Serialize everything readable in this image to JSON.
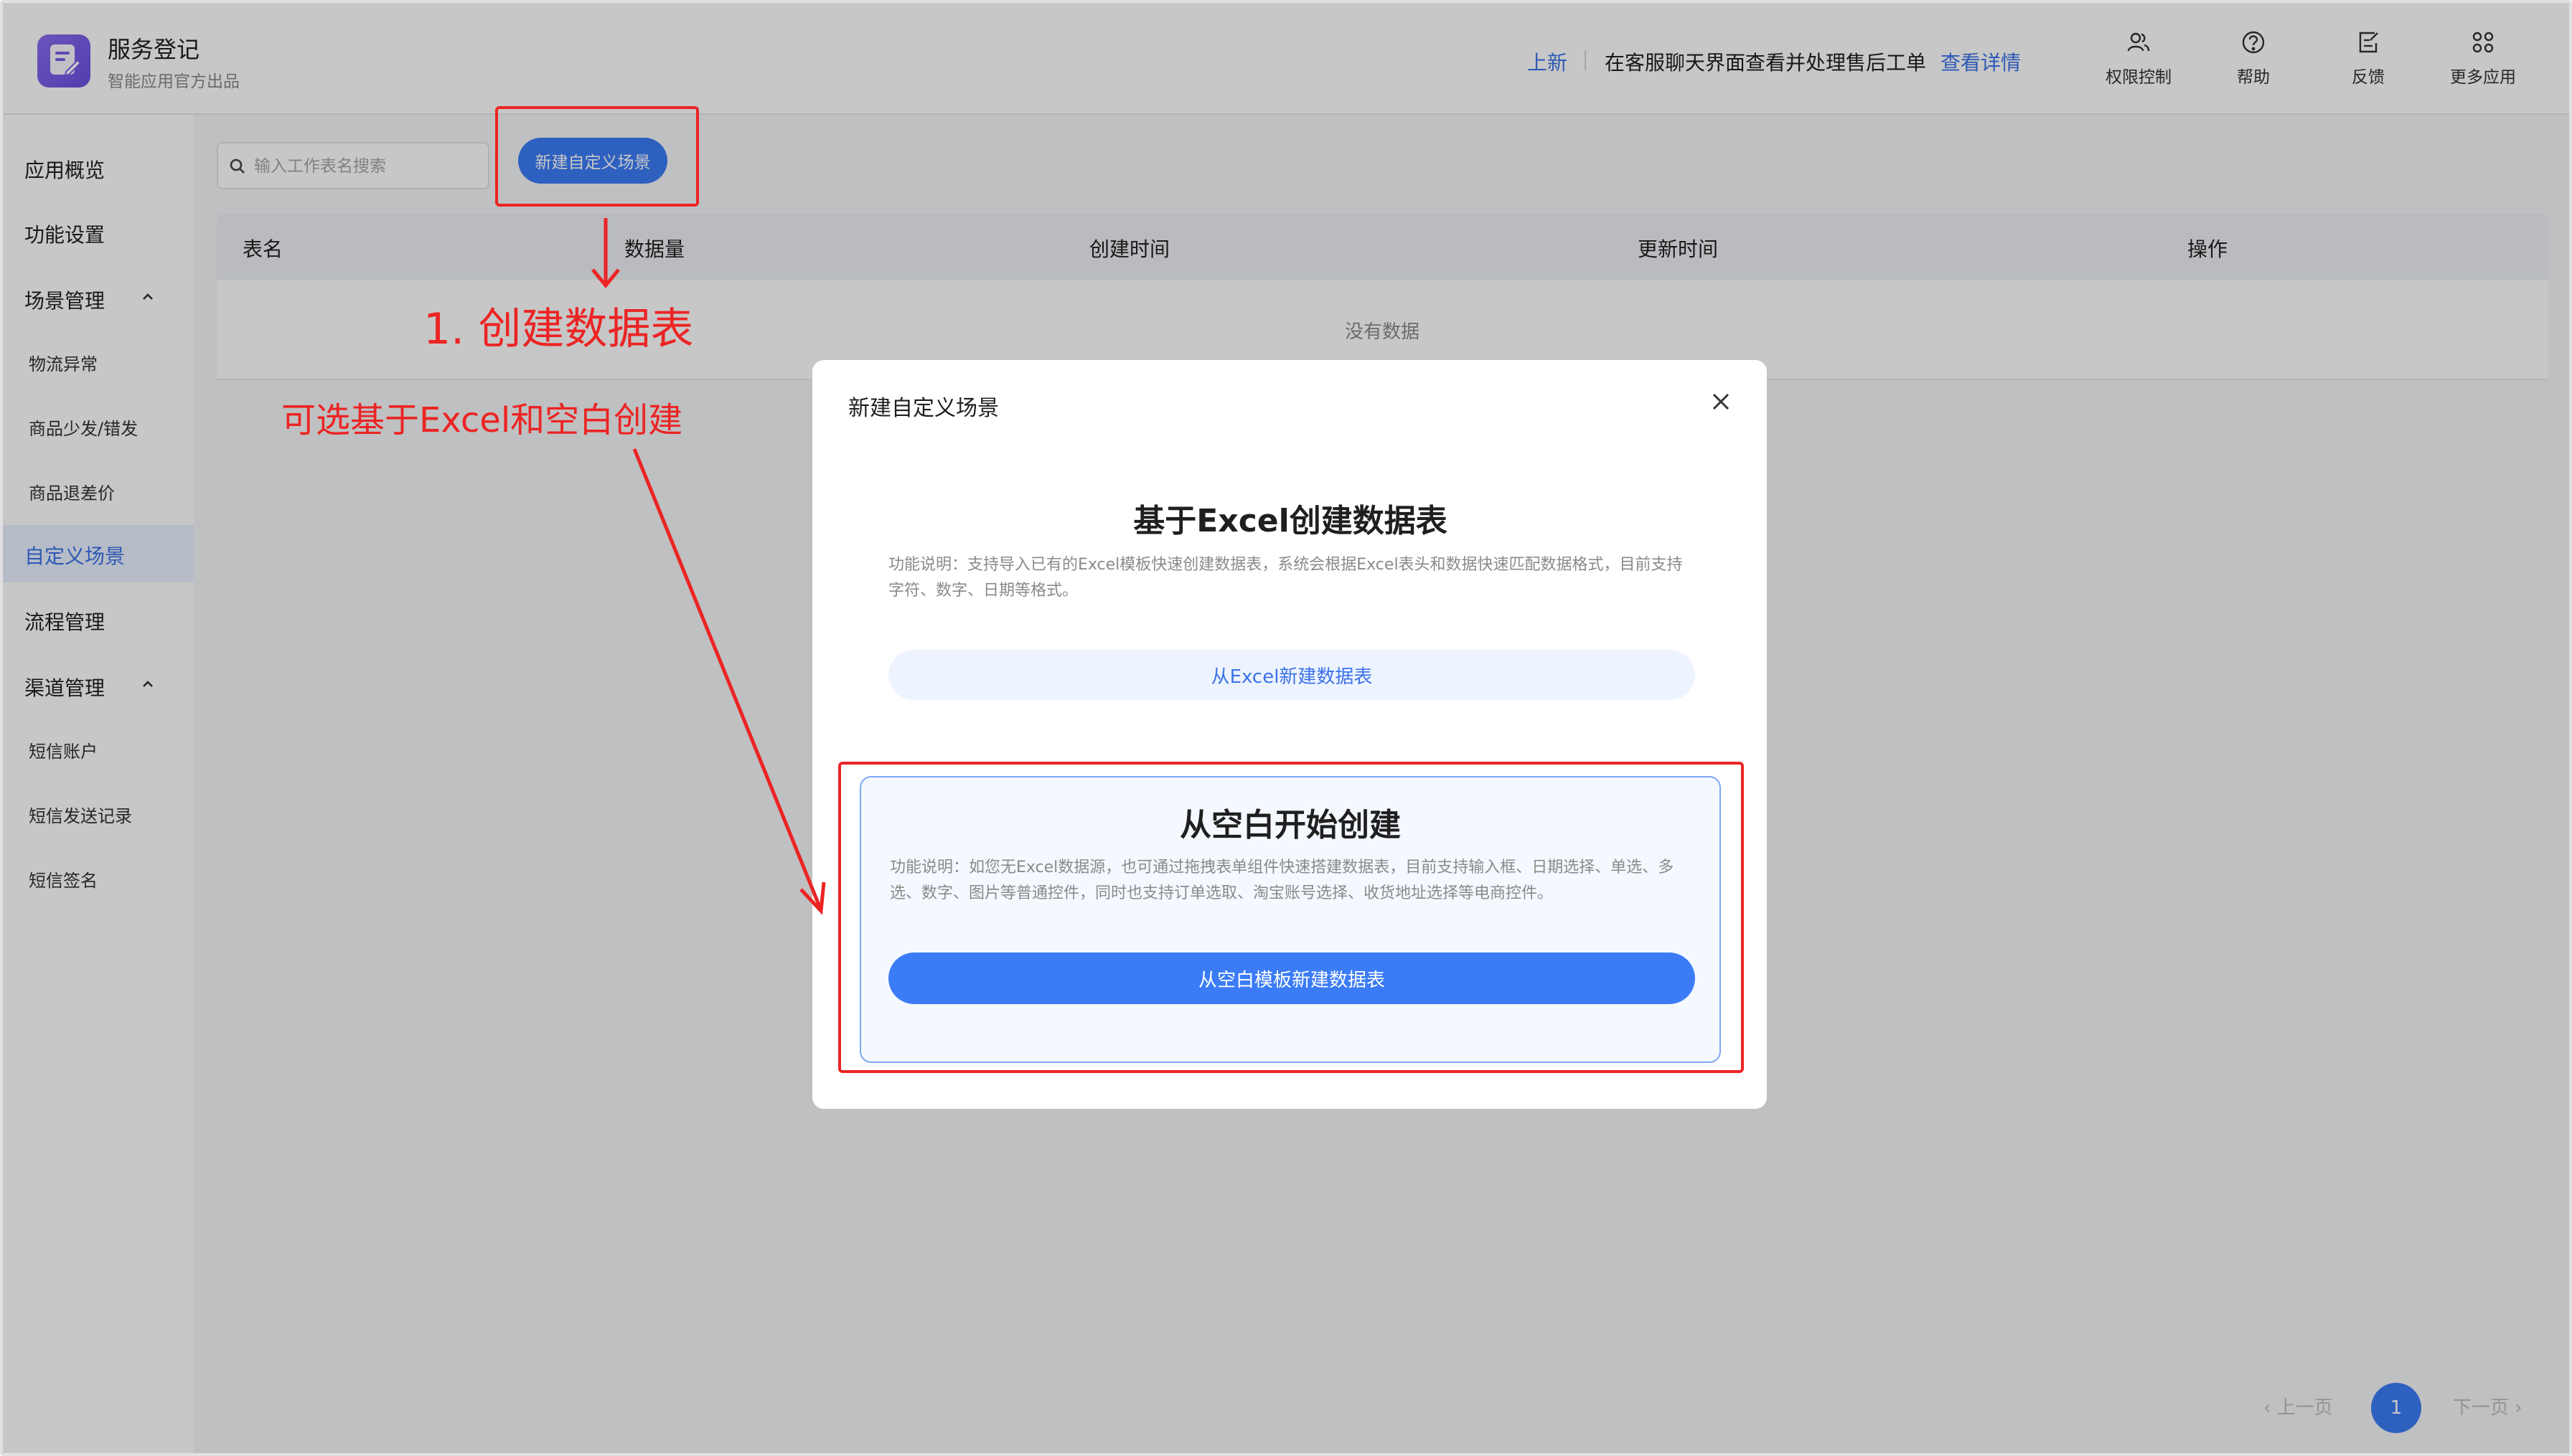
{
  "header": {
    "app_title": "服务登记",
    "app_subtitle": "智能应用官方出品",
    "notice_tag": "上新",
    "notice_text": "在客服聊天界面查看并处理售后工单",
    "notice_link": "查看详情",
    "tools": [
      {
        "label": "权限控制",
        "icon": "users-icon"
      },
      {
        "label": "帮助",
        "icon": "help-icon"
      },
      {
        "label": "反馈",
        "icon": "feedback-icon"
      },
      {
        "label": "更多应用",
        "icon": "more-apps-icon"
      }
    ]
  },
  "sidebar": {
    "items": [
      {
        "label": "应用概览"
      },
      {
        "label": "功能设置"
      },
      {
        "label": "场景管理"
      },
      {
        "label": "物流异常"
      },
      {
        "label": "商品少发/错发"
      },
      {
        "label": "商品退差价"
      },
      {
        "label": "自定义场景"
      },
      {
        "label": "流程管理"
      },
      {
        "label": "渠道管理"
      },
      {
        "label": "短信账户"
      },
      {
        "label": "短信发送记录"
      },
      {
        "label": "短信签名"
      }
    ]
  },
  "toolbar": {
    "search_placeholder": "输入工作表名搜索",
    "new_button": "新建自定义场景"
  },
  "table": {
    "columns": [
      "表名",
      "数据量",
      "创建时间",
      "更新时间",
      "操作"
    ],
    "empty_text": "没有数据"
  },
  "pagination": {
    "prev": "‹ 上一页",
    "current": "1",
    "next": "下一页 ›"
  },
  "modal": {
    "title": "新建自定义场景",
    "card_excel": {
      "title": "基于Excel创建数据表",
      "desc": "功能说明：支持导入已有的Excel模板快速创建数据表，系统会根据Excel表头和数据快速匹配数据格式，目前支持字符、数字、日期等格式。",
      "button": "从Excel新建数据表"
    },
    "card_blank": {
      "title": "从空白开始创建",
      "desc": "功能说明：如您无Excel数据源，也可通过拖拽表单组件快速搭建数据表，目前支持输入框、日期选择、单选、多选、数字、图片等普通控件，同时也支持订单选取、淘宝账号选择、收货地址选择等电商控件。",
      "button": "从空白模板新建数据表"
    }
  },
  "annotations": {
    "step_label": "1. 创建数据表",
    "hint_label": "可选基于Excel和空白创建",
    "color": "#ec2424"
  },
  "colors": {
    "primary": "#3b7cf6",
    "link": "#3b72e8",
    "annotation": "#ec2424"
  }
}
